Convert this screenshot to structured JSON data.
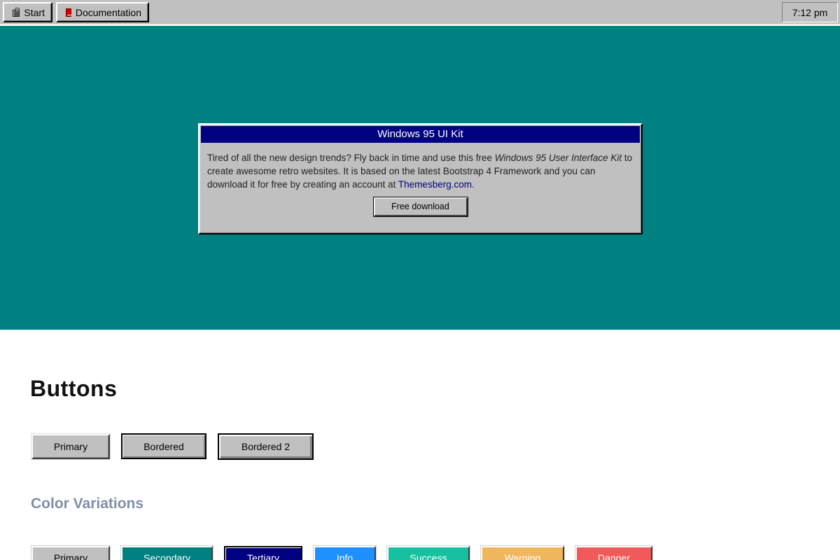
{
  "taskbar": {
    "start_label": "Start",
    "documentation_label": "Documentation",
    "clock": "7:12 pm",
    "icons": {
      "start": "computer-icon",
      "documentation": "book-icon"
    }
  },
  "window": {
    "title": "Windows 95 UI Kit",
    "text_before": "Tired of all the new design trends? Fly back in time and use this free ",
    "text_italic": "Windows 95 User Interface Kit",
    "text_middle": " to create awesome retro websites. It is based on the latest Bootstrap 4 Framework and you can download it for free by creating an account at ",
    "link_text": "Themesberg.com",
    "text_after": ".",
    "download_label": "Free download"
  },
  "buttons_section": {
    "title": "Buttons",
    "primary": "Primary",
    "bordered": "Bordered",
    "bordered2": "Bordered 2"
  },
  "color_section": {
    "title": "Color Variations",
    "buttons": [
      {
        "label": "Primary",
        "bg": "#c0c0c0",
        "fg": "#000000"
      },
      {
        "label": "Secondary",
        "bg": "#008080",
        "fg": "#ffffff"
      },
      {
        "label": "Tertiary",
        "bg": "#000080",
        "fg": "#ffffff"
      },
      {
        "label": "Info",
        "bg": "#1e90ff",
        "fg": "#ffffff"
      },
      {
        "label": "Success",
        "bg": "#17c1a0",
        "fg": "#ffffff"
      },
      {
        "label": "Warning",
        "bg": "#f0b65e",
        "fg": "#ffffff"
      },
      {
        "label": "Danger",
        "bg": "#f05a5a",
        "fg": "#ffffff"
      }
    ]
  },
  "colors": {
    "desktop": "#008080",
    "titlebar": "#000080",
    "chrome": "#c0c0c0"
  }
}
